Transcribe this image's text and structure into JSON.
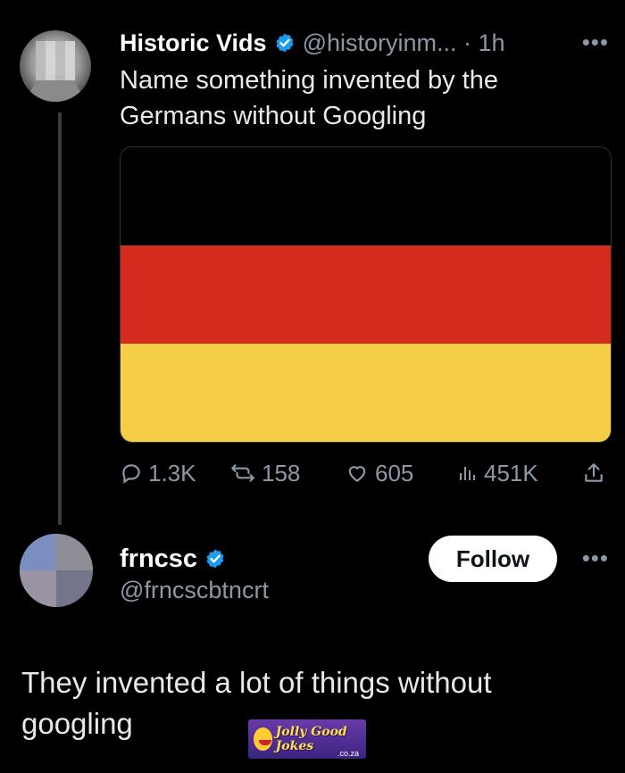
{
  "tweet": {
    "author_name": "Historic Vids",
    "handle_time": "@historyinm... · 1h",
    "more_icon": "more-horizontal-icon",
    "text_line1": "Name something invented by the",
    "text_line2": "Germans without Googling",
    "flag_colors": [
      "#000000",
      "#d32b1e",
      "#f6cd46"
    ],
    "replies": "1.3K",
    "reposts": "158",
    "likes": "605",
    "views": "451K"
  },
  "reply": {
    "author_name": "frncsc",
    "handle": "@frncscbtncrt",
    "follow_label": "Follow",
    "text_line1": "They invented a lot of things without",
    "text_line2": "googling"
  },
  "watermark": {
    "text": "Jolly Good Jokes",
    "sub": ".co.za"
  },
  "colors": {
    "verified": "#1d9bf0",
    "muted": "#8b98a5",
    "background": "#000000"
  }
}
